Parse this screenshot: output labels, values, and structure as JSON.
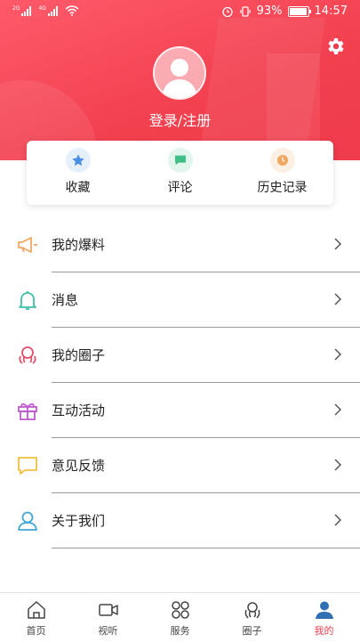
{
  "status_bar": {
    "sim1_tag": "2G",
    "sim2_tag": "4G",
    "battery_percent": "93%",
    "battery_level": 0.93,
    "time": "14:57"
  },
  "profile": {
    "login_label": "登录/注册"
  },
  "quick_actions": [
    {
      "label": "收藏",
      "icon": "star-icon",
      "color": "#4a90e2"
    },
    {
      "label": "评论",
      "icon": "comment-icon",
      "color": "#3fbf86"
    },
    {
      "label": "历史记录",
      "icon": "clock-icon",
      "color": "#f0a860"
    }
  ],
  "menu": [
    {
      "label": "我的爆料",
      "icon": "megaphone-icon",
      "color": "#f0a860"
    },
    {
      "label": "消息",
      "icon": "bell-icon",
      "color": "#3fbfa8"
    },
    {
      "label": "我的圈子",
      "icon": "circle-group-icon",
      "color": "#e0506a"
    },
    {
      "label": "互动活动",
      "icon": "gift-icon",
      "color": "#c05ad0"
    },
    {
      "label": "意见反馈",
      "icon": "feedback-icon",
      "color": "#f0c040"
    },
    {
      "label": "关于我们",
      "icon": "person-icon",
      "color": "#3fa8d8"
    }
  ],
  "bottom_nav": [
    {
      "label": "首页",
      "icon": "home-icon"
    },
    {
      "label": "视听",
      "icon": "video-icon"
    },
    {
      "label": "服务",
      "icon": "services-icon"
    },
    {
      "label": "圈子",
      "icon": "circle-icon"
    },
    {
      "label": "我的",
      "icon": "user-icon",
      "active": true
    }
  ],
  "colors": {
    "header_accent": "#ef3b4b",
    "active_tab": "#f0404f",
    "divider": "#9a9a9a"
  }
}
